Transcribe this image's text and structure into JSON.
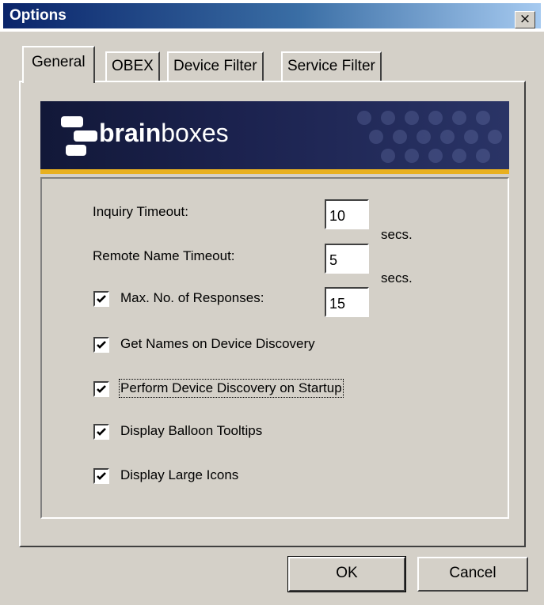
{
  "window": {
    "title": "Options",
    "close_glyph": "×"
  },
  "tabs": [
    {
      "label": "General",
      "active": true
    },
    {
      "label": "OBEX",
      "active": false
    },
    {
      "label": "Device Filter",
      "active": false
    },
    {
      "label": "Service Filter",
      "active": false
    }
  ],
  "banner": {
    "logo_bold": "brain",
    "logo_light": "boxes",
    "logo_icon": "brainboxes-logo-icon",
    "colors": {
      "background": "#1c2350",
      "stripe": "#e8b020"
    }
  },
  "settings": {
    "inquiry_timeout": {
      "label": "Inquiry Timeout:",
      "value": "10",
      "unit": "secs."
    },
    "remote_name_timeout": {
      "label": "Remote Name Timeout:",
      "value": "5",
      "unit": "secs."
    },
    "max_responses": {
      "label": "Max. No. of Responses:",
      "value": "15",
      "checked": true
    },
    "get_names": {
      "label": "Get Names on Device Discovery",
      "checked": true
    },
    "perform_discovery": {
      "label": "Perform Device Discovery on Startup",
      "checked": true
    },
    "balloon_tooltips": {
      "label": "Display Balloon Tooltips",
      "checked": true
    },
    "large_icons": {
      "label": "Display Large Icons",
      "checked": true
    }
  },
  "buttons": {
    "ok": "OK",
    "cancel": "Cancel"
  },
  "colors": {
    "titlebar_start": "#0a246a",
    "titlebar_end": "#a6caf0",
    "dialog": "#d4d0c8"
  }
}
